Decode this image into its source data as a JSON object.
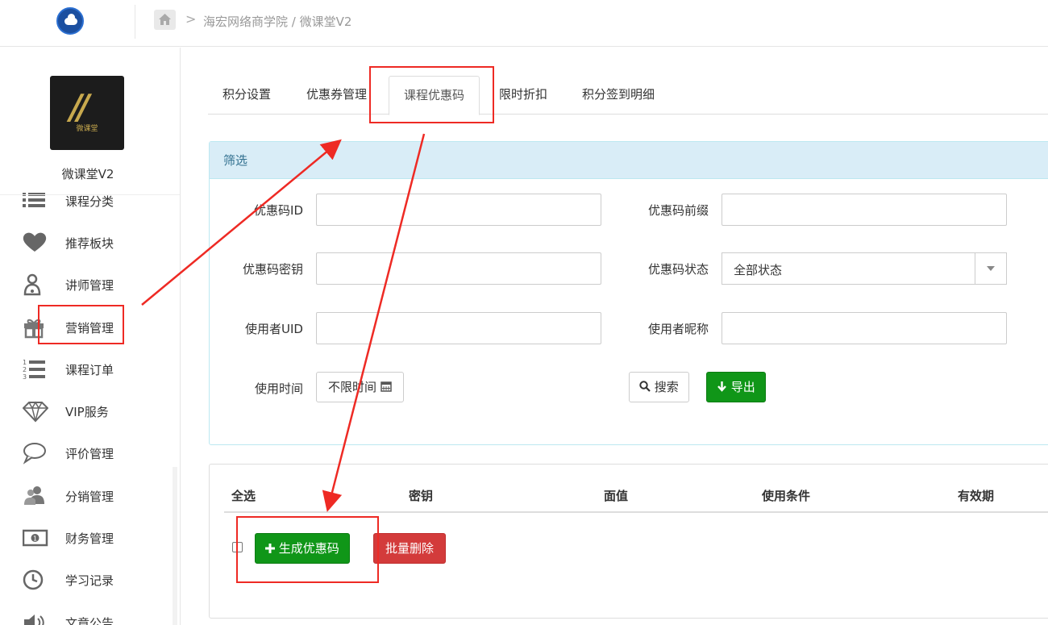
{
  "breadcrumb": {
    "path": "海宏网络商学院 / 微课堂V2",
    "separator": ">"
  },
  "brand": {
    "name": "微课堂V2",
    "logo_text": "微课堂",
    "logo_mark": "//"
  },
  "sidebar": {
    "items": [
      {
        "label": "课程分类",
        "icon": "list-icon"
      },
      {
        "label": "推荐板块",
        "icon": "heart-icon"
      },
      {
        "label": "讲师管理",
        "icon": "teacher-icon"
      },
      {
        "label": "营销管理",
        "icon": "gift-icon"
      },
      {
        "label": "课程订单",
        "icon": "ordered-list-icon"
      },
      {
        "label": "VIP服务",
        "icon": "diamond-icon"
      },
      {
        "label": "评价管理",
        "icon": "comment-icon"
      },
      {
        "label": "分销管理",
        "icon": "users-icon"
      },
      {
        "label": "财务管理",
        "icon": "money-icon"
      },
      {
        "label": "学习记录",
        "icon": "clock-icon"
      },
      {
        "label": "文章公告",
        "icon": "volume-icon"
      }
    ]
  },
  "tabs": [
    {
      "label": "积分设置",
      "active": false
    },
    {
      "label": "优惠券管理",
      "active": false
    },
    {
      "label": "课程优惠码",
      "active": true
    },
    {
      "label": "限时折扣",
      "active": false
    },
    {
      "label": "积分签到明细",
      "active": false
    }
  ],
  "filter": {
    "title": "筛选",
    "fields": {
      "code_id": {
        "label": "优惠码ID",
        "value": ""
      },
      "code_prefix": {
        "label": "优惠码前缀",
        "value": ""
      },
      "code_secret": {
        "label": "优惠码密钥",
        "value": ""
      },
      "code_status": {
        "label": "优惠码状态",
        "value": "全部状态"
      },
      "user_uid": {
        "label": "使用者UID",
        "value": ""
      },
      "user_nickname": {
        "label": "使用者昵称",
        "value": ""
      },
      "use_time": {
        "label": "使用时间",
        "value": "不限时间"
      }
    },
    "search_label": "搜索",
    "export_label": "导出"
  },
  "table": {
    "headers": [
      "全选",
      "密钥",
      "面值",
      "使用条件",
      "有效期"
    ],
    "rows": [],
    "generate_label": "生成优惠码",
    "batch_delete_label": "批量删除"
  },
  "colors": {
    "accent_green": "#109618",
    "danger_red": "#d33b3b",
    "panel_info": "#d9edf7",
    "annotation_red": "#ee2a24"
  }
}
